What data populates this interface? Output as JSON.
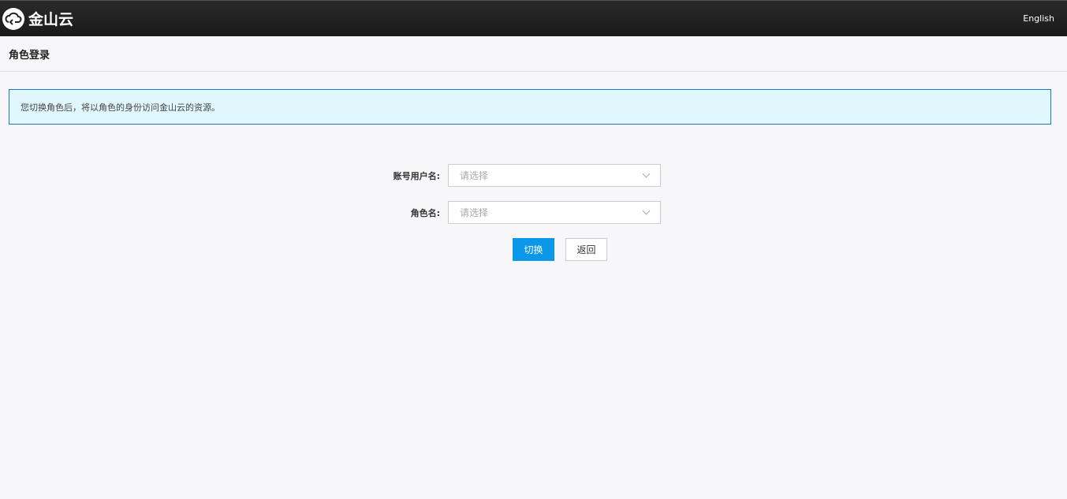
{
  "header": {
    "logo_text": "金山云",
    "language_link": "English"
  },
  "page": {
    "title": "角色登录"
  },
  "notice": {
    "text": "您切换角色后，将以角色的身份访问金山云的资源。"
  },
  "form": {
    "account": {
      "label": "账号用户名:",
      "placeholder": "请选择"
    },
    "role": {
      "label": "角色名:",
      "placeholder": "请选择"
    },
    "switch_label": "切换",
    "back_label": "返回"
  }
}
